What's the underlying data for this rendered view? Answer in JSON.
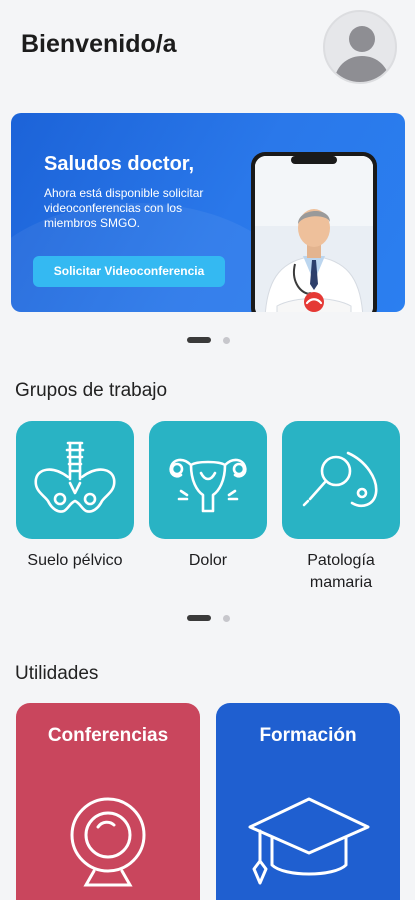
{
  "header": {
    "welcome": "Bienvenido/a",
    "avatar_icon": "user-avatar-icon"
  },
  "banner": {
    "title": "Saludos doctor,",
    "text": "Ahora está disponible solicitar videoconferencias con los miembros SMGO.",
    "button_label": "Solicitar Videoconferencia",
    "colors": {
      "background": "#1f6ae0",
      "button": "#34b9f2",
      "hangup": "#e53935"
    },
    "carousel": {
      "pages": 2,
      "active": 1
    }
  },
  "groups": {
    "title": "Grupos de trabajo",
    "items": [
      {
        "label": "Suelo pélvico",
        "icon": "pelvis-icon"
      },
      {
        "label": "Dolor",
        "icon": "uterus-icon"
      },
      {
        "label": "Patología mamaria",
        "icon": "breast-magnifier-icon"
      }
    ],
    "tile_color": "#29b3c4",
    "carousel": {
      "pages": 2,
      "active": 1
    }
  },
  "utilities": {
    "title": "Utilidades",
    "items": [
      {
        "label": "Conferencias",
        "icon": "webcam-icon",
        "color": "#c9465d"
      },
      {
        "label": "Formación",
        "icon": "graduation-cap-icon",
        "color": "#1f5fd0"
      }
    ]
  }
}
